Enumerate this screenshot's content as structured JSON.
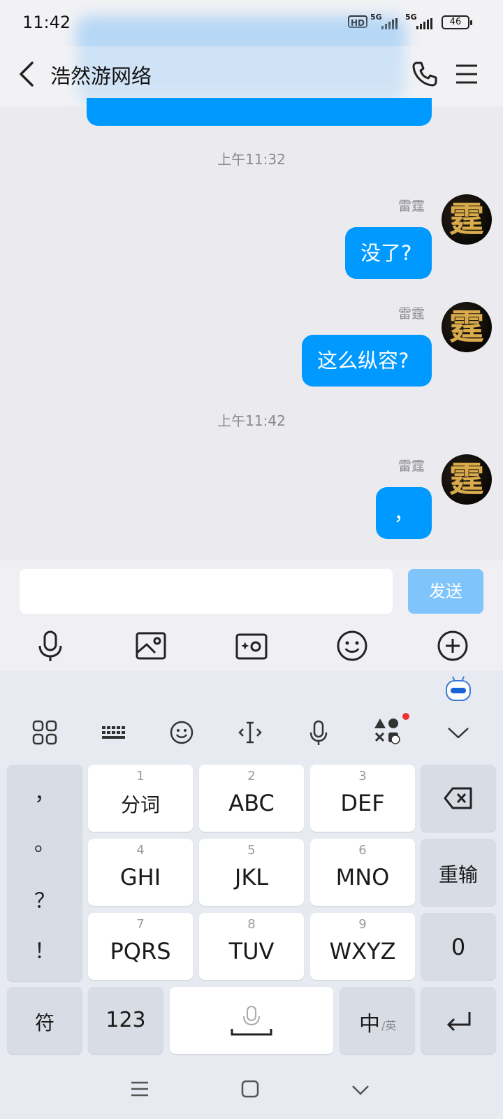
{
  "status_bar": {
    "time": "11:42",
    "hd_label": "HD",
    "net1": "5G",
    "net2": "5G",
    "battery": "46"
  },
  "header": {
    "title": "浩然游网络"
  },
  "messages": [
    {
      "type": "timestamp",
      "text": "上午11:32"
    },
    {
      "type": "outgoing",
      "sender": "雷霆",
      "text": "没了?"
    },
    {
      "type": "outgoing",
      "sender": "雷霆",
      "text": "这么纵容?"
    },
    {
      "type": "timestamp",
      "text": "上午11:42"
    },
    {
      "type": "outgoing",
      "sender": "雷霆",
      "text": "，"
    }
  ],
  "avatar_char": "霆",
  "composer": {
    "value": "",
    "send_label": "发送"
  },
  "keyboard": {
    "punct": [
      "，",
      "。",
      "？",
      "！"
    ],
    "keys": [
      {
        "num": "1",
        "label": "分词"
      },
      {
        "num": "2",
        "label": "ABC"
      },
      {
        "num": "3",
        "label": "DEF"
      },
      {
        "num": "4",
        "label": "GHI"
      },
      {
        "num": "5",
        "label": "JKL"
      },
      {
        "num": "6",
        "label": "MNO"
      },
      {
        "num": "7",
        "label": "PQRS"
      },
      {
        "num": "8",
        "label": "TUV"
      },
      {
        "num": "9",
        "label": "WXYZ"
      }
    ],
    "reinput": "重输",
    "zero": "0",
    "symbols": "符",
    "numbers": "123",
    "lang_main": "中",
    "lang_sub": "/英"
  },
  "colors": {
    "accent": "#0099ff",
    "send_disabled": "#7fc4fb"
  }
}
